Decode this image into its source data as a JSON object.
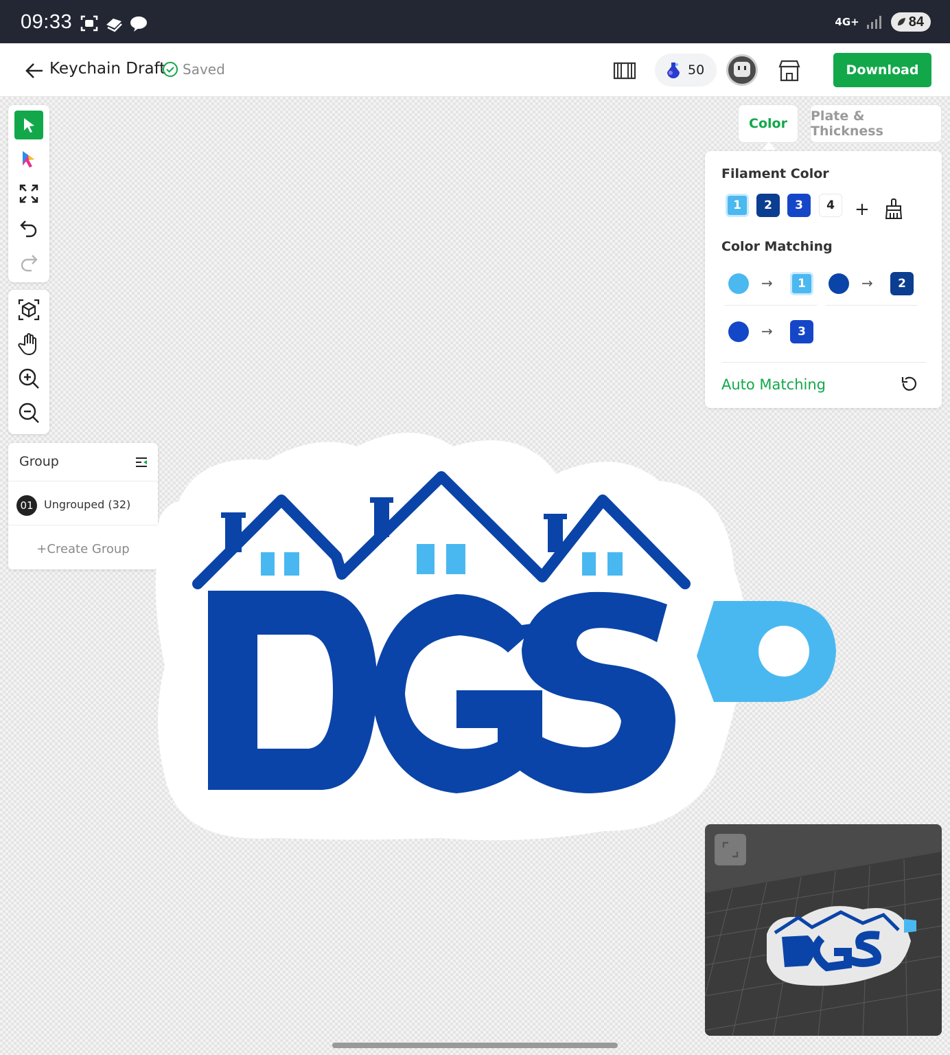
{
  "status_bar": {
    "time": "09:33",
    "network": "4G+",
    "battery": "84"
  },
  "header": {
    "title": "Keychain Draft",
    "saved_label": "Saved",
    "credits": "50",
    "download_label": "Download"
  },
  "toolbar": {
    "tools": [
      "select",
      "magic-select",
      "fit-to-screen",
      "undo",
      "redo"
    ],
    "view_tools": [
      "3d-view",
      "pan",
      "zoom-in",
      "zoom-out"
    ]
  },
  "group_panel": {
    "title": "Group",
    "groups": [
      {
        "num": "01",
        "label": "Ungrouped (32)"
      }
    ],
    "create_label": "Create Group"
  },
  "tabs": {
    "color": "Color",
    "plate": "Plate & Thickness"
  },
  "color_panel": {
    "filament_title": "Filament Color",
    "filaments": [
      {
        "num": "1",
        "color": "#4bb8f0"
      },
      {
        "num": "2",
        "color": "#0b3d91"
      },
      {
        "num": "3",
        "color": "#1646c8"
      },
      {
        "num": "4",
        "color": "#ffffff"
      }
    ],
    "matching_title": "Color Matching",
    "matches": [
      {
        "source": "#4bb8f0",
        "target": "1"
      },
      {
        "source": "#0a44a8",
        "target": "2"
      },
      {
        "source": "#1446c8",
        "target": "3"
      }
    ],
    "auto_matching_label": "Auto Matching"
  },
  "colors": {
    "accent": "#12a84a",
    "logo_blue": "#0a44a8",
    "logo_light": "#49b8f0"
  },
  "artwork_text": "DGS"
}
